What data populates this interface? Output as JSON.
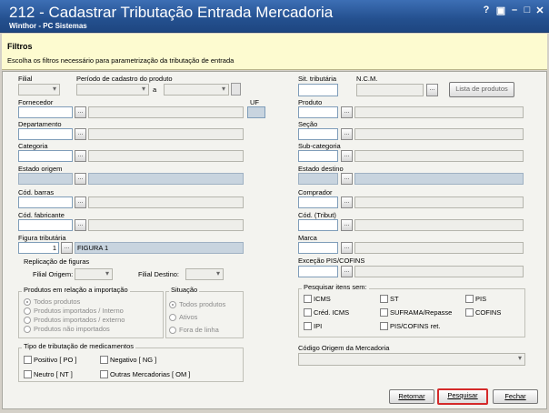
{
  "window": {
    "title": "212 - Cadastrar Tributação Entrada Mercadoria",
    "subtitle": "Winthor - PC Sistemas",
    "controls": [
      "?",
      "▣",
      "–",
      "□",
      "✕"
    ]
  },
  "header": {
    "title": "Filtros",
    "description": "Escolha os filtros necessário para parametrização da tributação de entrada"
  },
  "labels": {
    "filial": "Filial",
    "periodo": "Período de cadastro do produto",
    "a": "a",
    "fornecedor": "Fornecedor",
    "uf": "UF",
    "departamento": "Departamento",
    "categoria": "Categoria",
    "estado_origem": "Estado origem",
    "cod_barras": "Cód. barras",
    "cod_fabricante": "Cód. fabricante",
    "figura_tributaria": "Figura tributária",
    "sit_tributaria": "Sit. tributária",
    "ncm": "N.C.M.",
    "produto": "Produto",
    "secao": "Seção",
    "subcategoria": "Sub-categoria",
    "estado_destino": "Estado destino",
    "comprador": "Comprador",
    "cod_tribut": "Cód. (Tribut)",
    "marca": "Marca",
    "excecao": "Exceção PIS/COFINS",
    "codigo_origem": "Código Origem da Mercadoria"
  },
  "buttons": {
    "lista_produtos": "Lista de produtos",
    "ellipsis": "...",
    "retornar": "Retornar",
    "pesquisar": "Pesquisar",
    "fechar": "Fechar"
  },
  "figura": {
    "code": "1",
    "name": "FIGURA 1"
  },
  "replicacao": {
    "title": "Replicação de figuras",
    "filial_origem": "Filial Origem:",
    "filial_destino": "Filial Destino:"
  },
  "importacao": {
    "title": "Produtos em relação a importação",
    "options": [
      "Todos produtos",
      "Produtos importados / Interno",
      "Produtos importados / externo",
      "Produtos não importados"
    ]
  },
  "situacao": {
    "title": "Situação",
    "options": [
      "Todos produtos",
      "Ativos",
      "Fora de linha"
    ]
  },
  "medicamentos": {
    "title": "Tipo de tributação de medicamentos",
    "options": [
      "Positivo [ PO ]",
      "Negativo [ NG ]",
      "Neutro [ NT ]",
      "Outras Mercadorias [ OM ]"
    ]
  },
  "pesquisar_itens": {
    "title": "Pesquisar itens sem:",
    "options": [
      "ICMS",
      "ST",
      "PIS",
      "Créd. ICMS",
      "SUFRAMA/Repasse",
      "COFINS",
      "IPI",
      "PIS/COFINS ret."
    ]
  },
  "colors": {
    "title_bar": "#24508f",
    "header_bg": "#fdfbd0",
    "highlight": "#d42a2a"
  }
}
